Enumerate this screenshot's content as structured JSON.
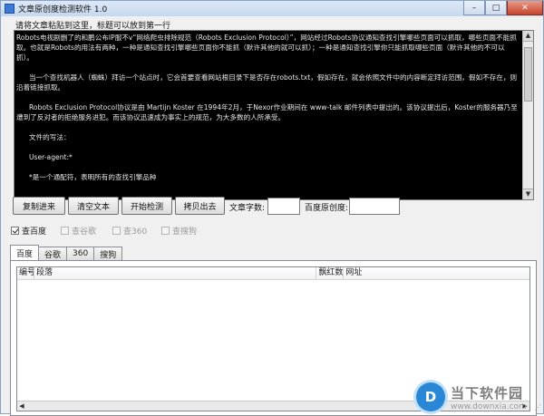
{
  "window": {
    "title": "文章原创度检测软件 1.0",
    "minimize": "–",
    "maximize": "□",
    "close": "✕"
  },
  "hint": "请将文章粘贴到这里，标题可以放到第一行",
  "article": {
    "paragraphs": [
      "Robots电视剧删了的和鹏公布IP服不v“网络爬虫排除规范（Robots Exclusion Protocol）”，网站经过Robots协议通知查找引擎哪些页面可以抓取，哪些页面不能抓取。也就是Robots的用法有两种，一种是通知查找引擎哪些页面你不能抓（默许其他的就可以抓）；一种是通知查找引擎你只能抓取哪些页面（默许其他的不可以抓）。",
      "当一个查找机器人（蜘蛛）拜访一个站点时，它会首要查看网站根目录下是否存在robots.txt，假如存在，就会依照文件中的内容断定拜访范围，假如不存在，则沿着链接抓取。",
      "Robots Exclusion Protocol协议是由 Martijn Koster 在1994年2月，于Nexor作业期间在 www-talk 邮件列表中提出的。该协议提出后，Koster的服务器乃至遭到了反对者的拒绝服务进犯。而该协议迅速成为事实上的规范，为大多数的人所承受。",
      "文件的写法：",
      "User-agent:*",
      "*是一个通配符，表明所有的查找引擎品种"
    ]
  },
  "toolbar": {
    "paste": "复制进来",
    "clear": "清空文本",
    "start": "开始检测",
    "copy_out": "拷贝出去",
    "word_count_label": "文章字数:",
    "word_count_value": "",
    "originality_label": "百度原创度:",
    "originality_value": ""
  },
  "engines": [
    {
      "label": "查百度",
      "checked": true,
      "enabled": true
    },
    {
      "label": "查谷歌",
      "checked": false,
      "enabled": false
    },
    {
      "label": "查360",
      "checked": false,
      "enabled": false
    },
    {
      "label": "查搜狗",
      "checked": false,
      "enabled": false
    }
  ],
  "tabs": [
    "百度",
    "谷歌",
    "360",
    "搜狗"
  ],
  "active_tab": "百度",
  "results": {
    "columns": [
      "编号",
      "段落",
      "飘红数",
      "网址"
    ],
    "rows": []
  },
  "watermark": {
    "logo_glyph": "D",
    "name": "当下软件园",
    "url": "www.downxia.com"
  }
}
